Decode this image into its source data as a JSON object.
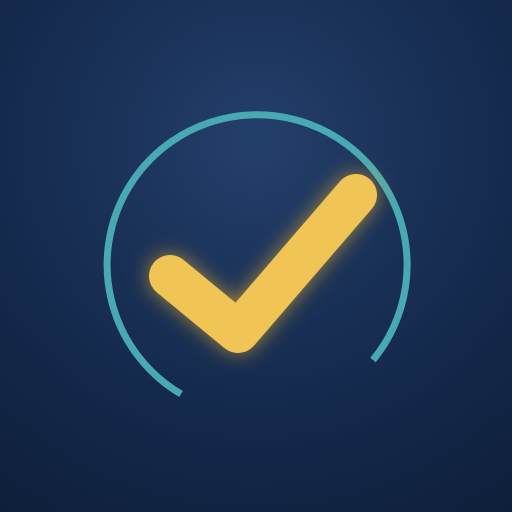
{
  "app_icon": {
    "icon_name": "checkmark-progress-ring-icon",
    "colors": {
      "background_top": "#23406c",
      "background_bottom": "#0e1f3a",
      "ring": "#49a9b3",
      "checkmark": "#f0c455",
      "checkmark_glow": "#f6cf58"
    }
  }
}
